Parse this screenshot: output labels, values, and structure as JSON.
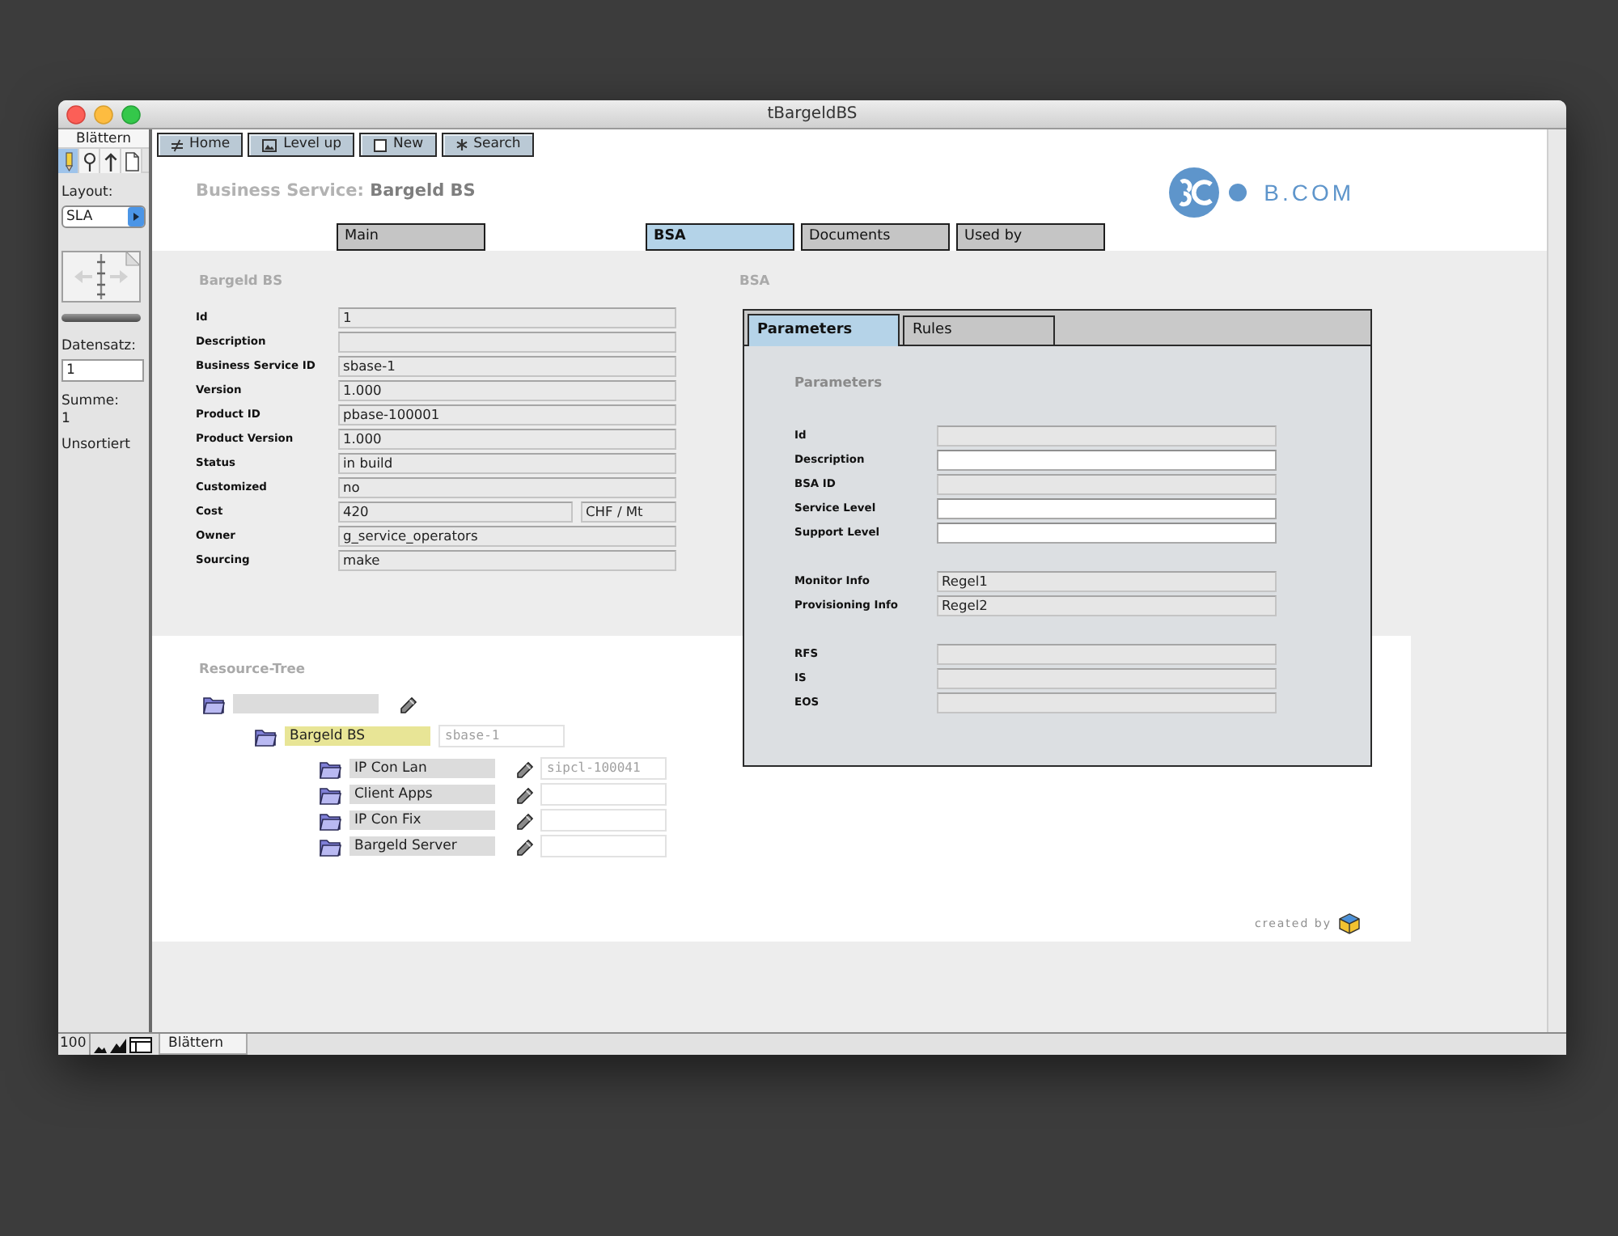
{
  "window": {
    "title": "tBargeldBS"
  },
  "sidebar": {
    "title": "Blättern",
    "modes": [
      {
        "kind": "browse",
        "selected": true
      },
      {
        "kind": "find",
        "selected": false
      },
      {
        "kind": "layout",
        "selected": false
      },
      {
        "kind": "preview",
        "selected": false
      }
    ],
    "layout_label": "Layout:",
    "layout_value": "SLA",
    "record_label": "Datensatz:",
    "record_value": "1",
    "total_label": "Summe:",
    "total_value": "1",
    "sort_status": "Unsortiert"
  },
  "toolbar": [
    {
      "kind": "home",
      "label": "Home"
    },
    {
      "kind": "level_up",
      "label": "Level up"
    },
    {
      "kind": "new",
      "label": "New"
    },
    {
      "kind": "search",
      "label": "Search"
    }
  ],
  "header": {
    "title_prefix": "Business Service:",
    "title_name": "Bargeld BS",
    "logo_text": "B.COM"
  },
  "tabs": [
    {
      "label": "Main",
      "selected": false
    },
    {
      "label": "BSA",
      "selected": true
    },
    {
      "label": "Documents",
      "selected": false
    },
    {
      "label": "Used by",
      "selected": false
    }
  ],
  "main_section": {
    "heading": "Bargeld BS",
    "fields": [
      {
        "label": "Id",
        "value": "1"
      },
      {
        "label": "Description"
      },
      {
        "label": "Business Service ID",
        "value": "sbase-1"
      },
      {
        "label": "Version",
        "value": "1.000"
      },
      {
        "label": "Product ID",
        "value": "pbase-100001"
      },
      {
        "label": "Product Version",
        "value": "1.000"
      },
      {
        "label": "Status",
        "value": "in build"
      },
      {
        "label": "Customized",
        "value": "no"
      },
      {
        "label": "Cost",
        "value": "420",
        "unit": "CHF / Mt"
      },
      {
        "label": "Owner",
        "value": "g_service_operators"
      },
      {
        "label": "Sourcing",
        "value": "make"
      }
    ]
  },
  "bsa_section": {
    "heading": "BSA",
    "tabs": [
      {
        "label": "Parameters",
        "selected": true
      },
      {
        "label": "Rules",
        "selected": false
      }
    ],
    "subheading": "Parameters",
    "field_groups": [
      {
        "fields": [
          {
            "label": "Id",
            "editable": false
          },
          {
            "label": "Description",
            "editable": true
          },
          {
            "label": "BSA ID",
            "editable": false
          },
          {
            "label": "Service Level",
            "editable": true
          },
          {
            "label": "Support Level",
            "editable": true
          }
        ]
      },
      {
        "fields": [
          {
            "label": "Monitor Info",
            "value": "Regel1",
            "editable": false
          },
          {
            "label": "Provisioning Info",
            "value": "Regel2",
            "editable": false
          }
        ]
      },
      {
        "fields": [
          {
            "label": "RFS",
            "editable": false
          },
          {
            "label": "IS",
            "editable": false
          },
          {
            "label": "EOS",
            "editable": false
          }
        ]
      }
    ]
  },
  "resource_tree": {
    "heading": "Resource-Tree",
    "nodes": [
      {
        "kind": "root",
        "selected": false,
        "children": [
          {
            "kind": "service",
            "name": "Bargeld BS",
            "id": "sbase-1",
            "selected": true,
            "children": [
              {
                "kind": "resource",
                "name": "IP Con Lan",
                "id": "sipcl-100041",
                "selected": false
              },
              {
                "kind": "resource",
                "name": "Client Apps",
                "selected": false
              },
              {
                "kind": "resource",
                "name": "IP Con Fix",
                "selected": false
              },
              {
                "kind": "resource",
                "name": "Bargeld Server",
                "selected": false
              }
            ]
          }
        ]
      }
    ]
  },
  "footer": {
    "credit": "created by"
  },
  "status_bar": {
    "zoom": "100",
    "mode": "Blättern"
  }
}
